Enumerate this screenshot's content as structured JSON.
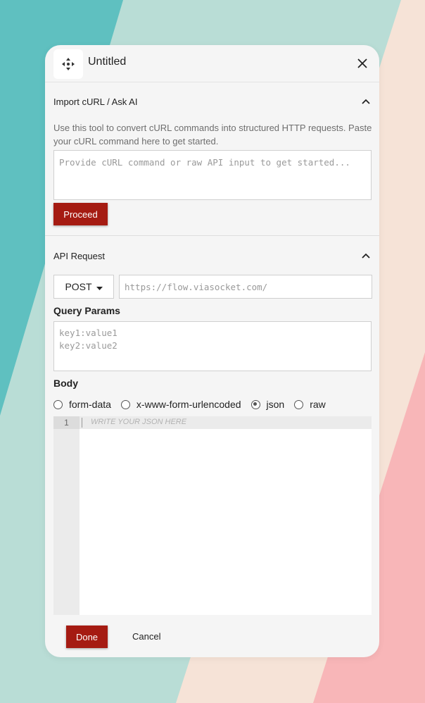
{
  "dialog": {
    "title": "Untitled"
  },
  "import_section": {
    "title": "Import cURL / Ask AI",
    "description": "Use this tool to convert cURL commands into structured HTTP requests. Paste your cURL command here to get started.",
    "input_placeholder": "Provide cURL command or raw API input to get started...",
    "input_value": "",
    "proceed_label": "Proceed"
  },
  "api_section": {
    "title": "API Request",
    "method": "POST",
    "url_placeholder": "https://flow.viasocket.com/",
    "query_params_label": "Query Params",
    "query_params_placeholder": "key1:value1\nkey2:value2",
    "body_label": "Body",
    "body_types": [
      {
        "label": "form-data",
        "checked": false
      },
      {
        "label": "x-www-form-urlencoded",
        "checked": false
      },
      {
        "label": "json",
        "checked": true
      },
      {
        "label": "raw",
        "checked": false
      }
    ],
    "editor": {
      "line_number": "1",
      "placeholder": "WRITE YOUR JSON HERE"
    }
  },
  "footer": {
    "done_label": "Done",
    "cancel_label": "Cancel"
  },
  "colors": {
    "accent": "#a51b12",
    "bg_teal": "#5fc0c0",
    "bg_mint": "#b9ddd6",
    "bg_peach": "#f6e3d7",
    "bg_pink": "#f8b6b8"
  },
  "icons": {
    "app": "move-arrows-icon",
    "close": "close-icon",
    "collapse": "chevron-up-icon",
    "dropdown": "caret-down-icon"
  }
}
